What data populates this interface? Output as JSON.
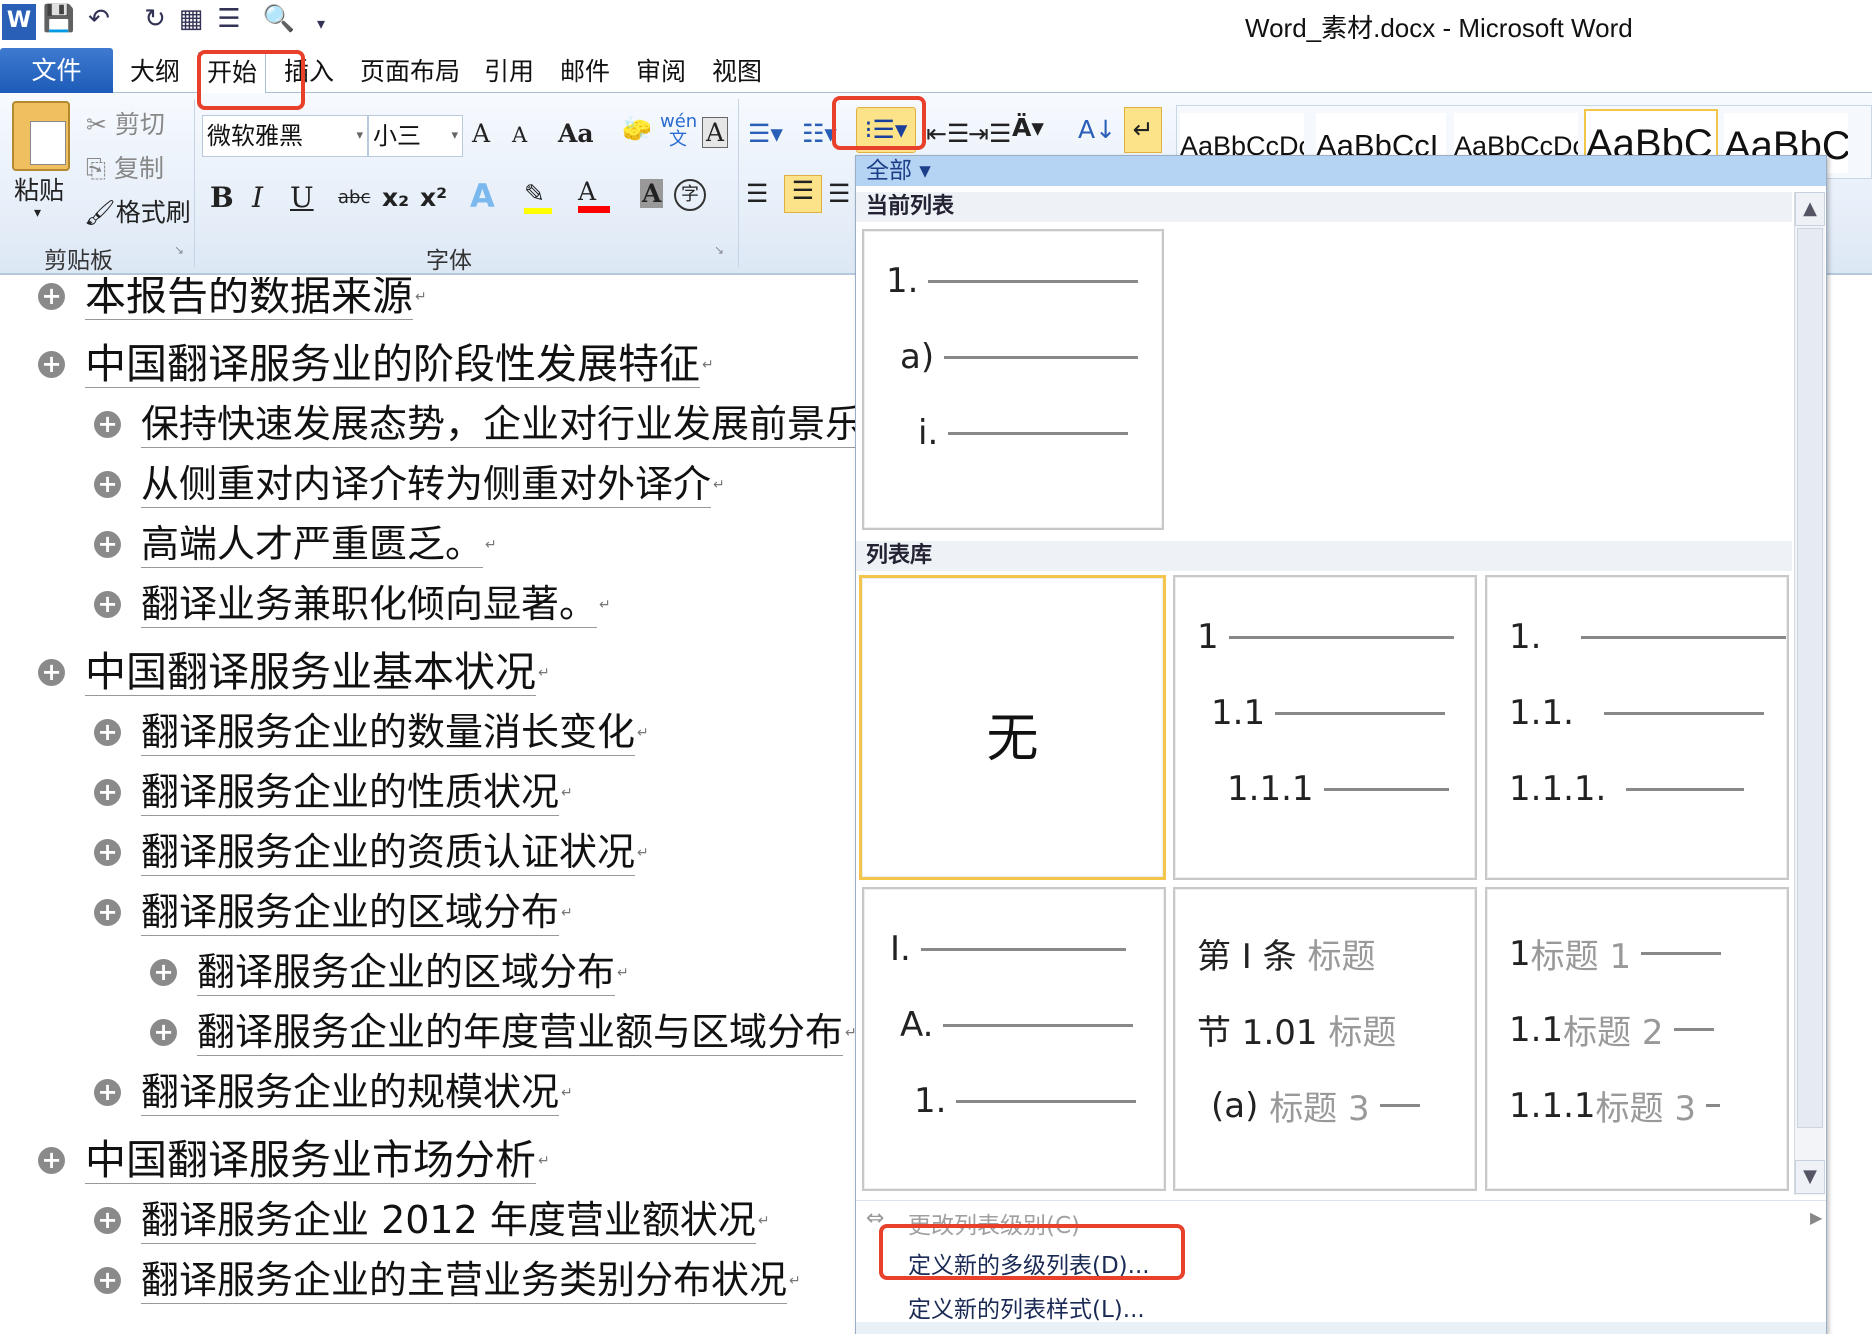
{
  "window": {
    "title": "Word_素材.docx - Microsoft Word"
  },
  "quick_access": [
    "word-logo",
    "save",
    "undo",
    "redo",
    "print-layout",
    "print",
    "print-preview",
    "customize"
  ],
  "tabs": [
    {
      "label": "文件"
    },
    {
      "label": "大纲"
    },
    {
      "label": "开始"
    },
    {
      "label": "插入"
    },
    {
      "label": "页面布局"
    },
    {
      "label": "引用"
    },
    {
      "label": "邮件"
    },
    {
      "label": "审阅"
    },
    {
      "label": "视图"
    }
  ],
  "ribbon": {
    "clipboard": {
      "label": "剪贴板",
      "paste": "粘贴",
      "cut": "剪切",
      "copy": "复制",
      "format_painter": "格式刷"
    },
    "font": {
      "label": "字体",
      "font_name": "微软雅黑",
      "font_size": "小三",
      "bold": "B",
      "italic": "I",
      "underline": "U",
      "strike": "abc",
      "sub": "x₂",
      "sup": "x²",
      "grow": "A",
      "shrink": "A",
      "case": "Aa",
      "pinyin": "wén 文",
      "border": "A",
      "effects": "A",
      "highlight_color": "#ffff00",
      "font_color": "#ff0000",
      "shade": "A",
      "enclose": "字"
    },
    "styles": [
      "AaBbCcDc",
      "AaBbCcI",
      "AaBbCcDc",
      "AaBbC",
      "AaBbCc"
    ]
  },
  "document": {
    "items": [
      {
        "level": 1,
        "text": "本报告的数据来源"
      },
      {
        "level": 1,
        "text": "中国翻译服务业的阶段性发展特征"
      },
      {
        "level": 2,
        "text": "保持快速发展态势，企业对行业发展前景乐观"
      },
      {
        "level": 2,
        "text": "从侧重对内译介转为侧重对外译介"
      },
      {
        "level": 2,
        "text": "高端人才严重匮乏。"
      },
      {
        "level": 2,
        "text": "翻译业务兼职化倾向显著。"
      },
      {
        "level": 1,
        "text": "中国翻译服务业基本状况"
      },
      {
        "level": 2,
        "text": "翻译服务企业的数量消长变化"
      },
      {
        "level": 2,
        "text": "翻译服务企业的性质状况"
      },
      {
        "level": 2,
        "text": "翻译服务企业的资质认证状况"
      },
      {
        "level": 2,
        "text": "翻译服务企业的区域分布"
      },
      {
        "level": 3,
        "text": "翻译服务企业的区域分布"
      },
      {
        "level": 3,
        "text": "翻译服务企业的年度营业额与区域分布"
      },
      {
        "level": 2,
        "text": "翻译服务企业的规模状况"
      },
      {
        "level": 1,
        "text": "中国翻译服务业市场分析"
      },
      {
        "level": 2,
        "text": "翻译服务企业 2012 年度营业额状况"
      },
      {
        "level": 2,
        "text": "翻译服务企业的主营业务类别分布状况"
      }
    ]
  },
  "dropdown": {
    "filter": "全部 ▾",
    "current_section": "当前列表",
    "current_list": [
      "1.",
      "a)",
      "i."
    ],
    "library_section": "列表库",
    "library": [
      {
        "none": "无"
      },
      {
        "levels": [
          "1",
          "1.1",
          "1.1.1"
        ]
      },
      {
        "levels": [
          "1.",
          "1.1.",
          "1.1.1."
        ]
      },
      {
        "levels": [
          "I.",
          "A.",
          "1."
        ]
      },
      {
        "levels": [
          [
            "第 Ⅰ 条",
            "标题"
          ],
          [
            "节 1.01",
            "标题"
          ],
          [
            "(a)",
            "标题 3"
          ]
        ]
      },
      {
        "levels": [
          [
            "1",
            "标题 1"
          ],
          [
            "1.1",
            "标题 2"
          ],
          [
            "1.1.1",
            "标题 3"
          ]
        ]
      }
    ],
    "menu": {
      "change_level": "更改列表级别(C)",
      "define_multilevel": "定义新的多级列表(D)...",
      "define_style": "定义新的列表样式(L)..."
    },
    "selected_style": "无"
  },
  "colors": {
    "highlight_box": "#e8402a",
    "active_button": "#fce38a",
    "file_tab": "#2a66c2",
    "filter_bar": "#b5d3f3"
  }
}
